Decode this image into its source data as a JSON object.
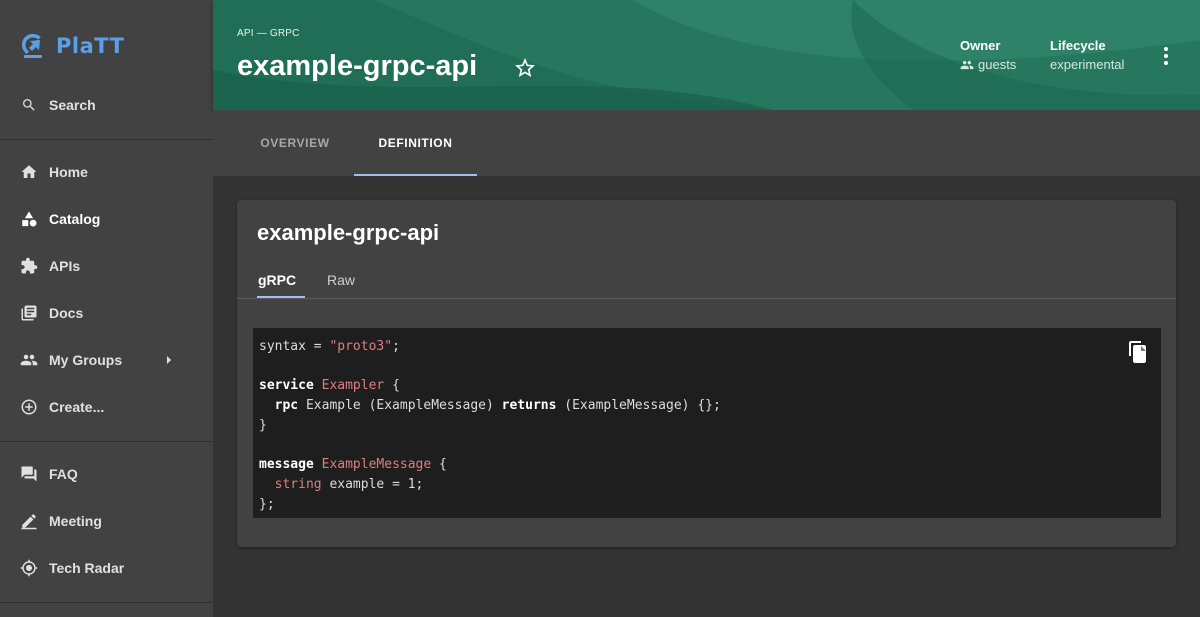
{
  "app": {
    "name": "PlaTT",
    "brand_color": "#5aa0e6"
  },
  "sidebar": {
    "search_label": "Search",
    "items": [
      {
        "label": "Home",
        "icon": "home-icon"
      },
      {
        "label": "Catalog",
        "icon": "catalog-icon",
        "active": true
      },
      {
        "label": "APIs",
        "icon": "puzzle-icon"
      },
      {
        "label": "Docs",
        "icon": "docs-icon"
      },
      {
        "label": "My Groups",
        "icon": "group-icon",
        "has_submenu": true
      },
      {
        "label": "Create...",
        "icon": "add-circle-icon"
      }
    ],
    "secondary": [
      {
        "label": "FAQ",
        "icon": "forum-icon"
      },
      {
        "label": "Meeting",
        "icon": "pencil-icon"
      },
      {
        "label": "Tech Radar",
        "icon": "radar-icon"
      }
    ]
  },
  "header": {
    "breadcrumb": "API — GRPC",
    "title": "example-grpc-api",
    "owner_label": "Owner",
    "owner_value": "guests",
    "lifecycle_label": "Lifecycle",
    "lifecycle_value": "experimental",
    "accent_color": "#1f6e55"
  },
  "tabs": [
    {
      "label": "OVERVIEW"
    },
    {
      "label": "DEFINITION",
      "active": true
    }
  ],
  "card": {
    "title": "example-grpc-api",
    "subtabs": [
      {
        "label": "gRPC",
        "active": true
      },
      {
        "label": "Raw"
      }
    ],
    "code": {
      "l1_a": "syntax = ",
      "l1_str": "\"proto3\"",
      "l1_b": ";",
      "l3_kw": "service",
      "l3_name": "Exampler",
      "l3_b": " {",
      "l4_indent": "  ",
      "l4_kw": "rpc",
      "l4_a": " Example (ExampleMessage) ",
      "l4_kw2": "returns",
      "l4_b": " (ExampleMessage) {};",
      "l5": "}",
      "l7_kw": "message",
      "l7_name": "ExampleMessage",
      "l7_b": " {",
      "l8_indent": "  ",
      "l8_type": "string",
      "l8_b": " example = 1;",
      "l9": "};"
    }
  }
}
